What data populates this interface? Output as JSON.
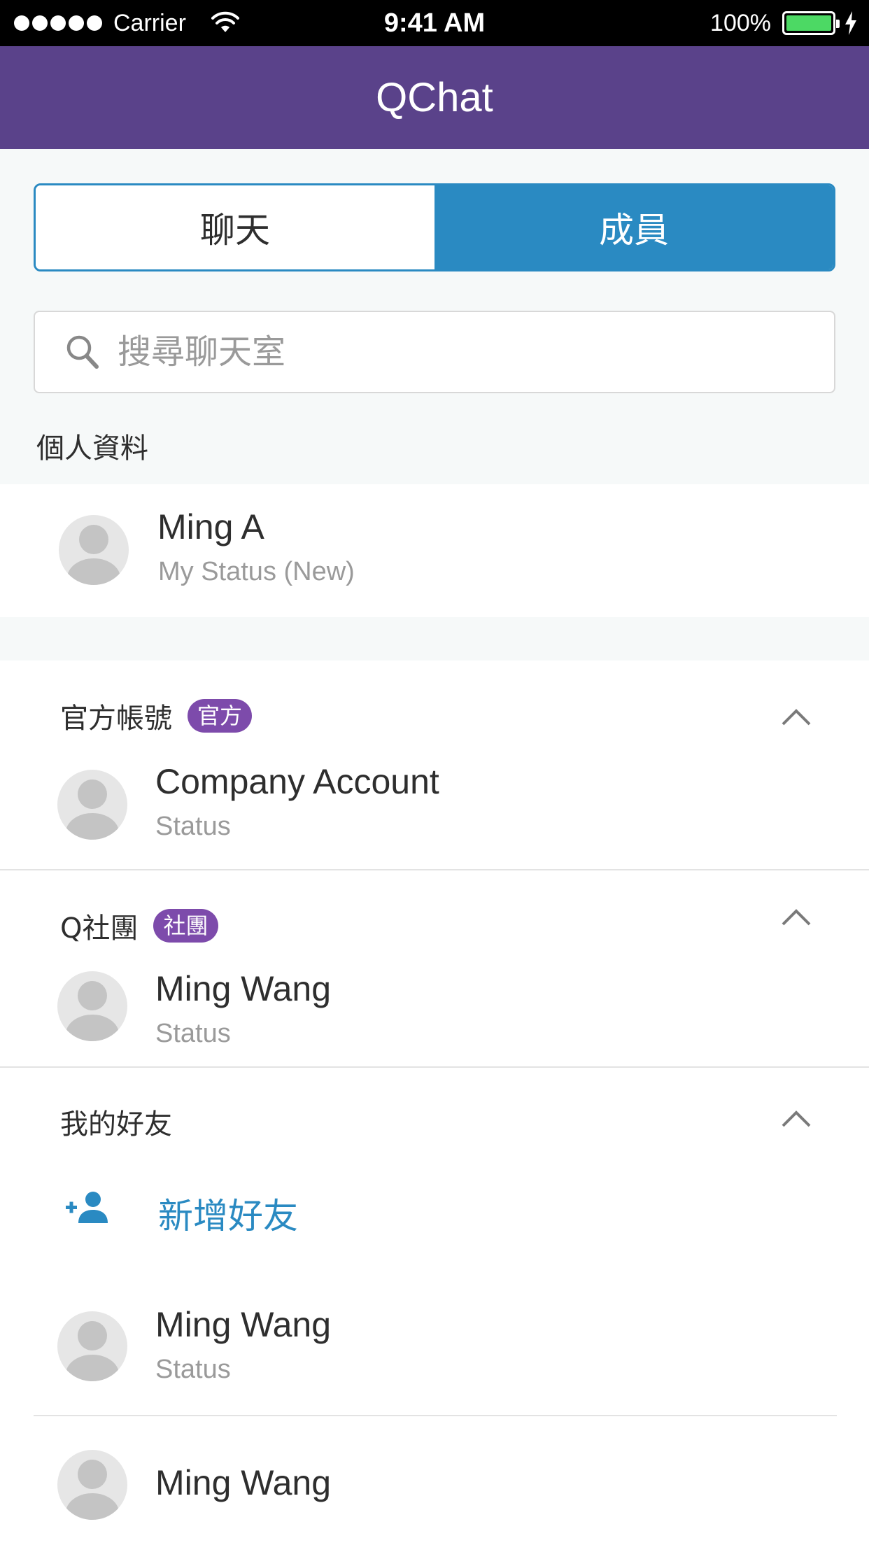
{
  "status_bar": {
    "carrier": "Carrier",
    "time": "9:41 AM",
    "battery": "100%"
  },
  "nav": {
    "title": "QChat"
  },
  "tabs": [
    {
      "label": "聊天",
      "active": false
    },
    {
      "label": "成員",
      "active": true
    }
  ],
  "search": {
    "placeholder": "搜尋聊天室",
    "value": ""
  },
  "profile": {
    "section_label": "個人資料",
    "name": "Ming A",
    "status": "My Status (New)"
  },
  "groups": [
    {
      "title": "官方帳號",
      "badge": "官方",
      "members": [
        {
          "name": "Company Account",
          "status": "Status"
        }
      ]
    },
    {
      "title": "Q社團",
      "badge": "社團",
      "members": [
        {
          "name": "Ming Wang",
          "status": "Status"
        }
      ]
    },
    {
      "title": "我的好友",
      "add_label": "新增好友",
      "members": [
        {
          "name": "Ming Wang",
          "status": "Status"
        },
        {
          "name": "Ming Wang"
        }
      ]
    }
  ],
  "colors": {
    "nav": "#5a428a",
    "accent": "#2a8ac2",
    "badge": "#7d4bab",
    "battery": "#4cd964"
  }
}
